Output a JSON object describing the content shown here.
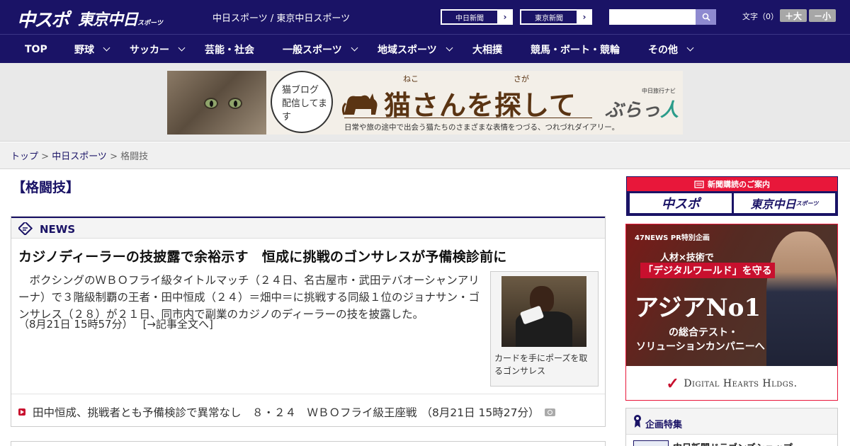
{
  "header": {
    "logo_chuspo": "中スポ",
    "logo_tokyo": "東京中日",
    "logo_tokyo_small": "スポーツ",
    "sites_link": "中日スポーツ / 東京中日スポーツ",
    "chunichi_btn": "中日新聞",
    "tokyo_btn": "東京新聞",
    "arrow": "›",
    "search_placeholder": "",
    "font_size_label": "文字（0）",
    "font_bigger": "＋大",
    "font_smaller": "－小"
  },
  "nav": {
    "items": [
      {
        "label": "TOP"
      },
      {
        "label": "野球"
      },
      {
        "label": "サッカー"
      },
      {
        "label": "芸能・社会"
      },
      {
        "label": "一般スポーツ"
      },
      {
        "label": "地域スポーツ"
      },
      {
        "label": "大相撲"
      },
      {
        "label": "競馬・ボート・競輪"
      },
      {
        "label": "その他"
      }
    ]
  },
  "banner_ad": {
    "bubble_text": "猫ブログ配信してます",
    "title": "猫さんを探して",
    "ruby_neko": "ねこ",
    "ruby_saga": "さが",
    "brand_sub": "中日旅行ナビ",
    "brand": "ぶらっ",
    "brand_accent": "人",
    "tagline": "日常や旅の途中で出会う猫たちのさまざまな表情をつづる、つれづれダイアリー。"
  },
  "breadcrumb": {
    "top": "トップ",
    "sep": " > ",
    "chunichi": "中日スポーツ",
    "current": "格闘技"
  },
  "main": {
    "heading": "【格闘技】",
    "news_label": "NEWS",
    "article": {
      "title": "カジノディーラーの技披露で余裕示す　恒成に挑戦のゴンサレスが予備検診前に",
      "body": "ボクシングのＷＢＯフライ級タイトルマッチ（２４日、名古屋市・武田テバオーシャンアリーナ）で３階級制覇の王者・田中恒成（２４）＝畑中＝に挑戦する同級１位のジョナサン・ゴンサレス（２８）が２１日、同市内で副業のカジノのディーラーの技を披露した。",
      "date": "（8月21日 15時57分）",
      "more_link": "[→記事全文へ]",
      "photo_caption": "カードを手にポーズを取るゴンサレス"
    },
    "related": {
      "text": "田中恒成、挑戦者とも予備検診で異常なし　８・２４　ＷＢＯフライ級王座戦",
      "date": "（8月21日 15時27分）"
    }
  },
  "sidebar": {
    "subscribe_head": "新聞購読のご案内",
    "sub_chuspo": "中スポ",
    "sub_tokyo": "東京中日",
    "sub_tokyo_small": "スポーツ",
    "ad": {
      "pr": "47NEWS PR特別企画",
      "line1": "人材×技術で",
      "line2": "「デジタルワールド」を守る",
      "line3": "アジアNo1",
      "line4": "の総合テスト・",
      "line5": "ソリューションカンパニーへ",
      "company": "Digital Hearts Hldgs."
    },
    "feature_title": "企画特集",
    "feature_item": "中日新聞ドラゴンズショップ"
  },
  "colors": {
    "brand_navy": "#1a1366",
    "accent_red": "#e8173a"
  }
}
